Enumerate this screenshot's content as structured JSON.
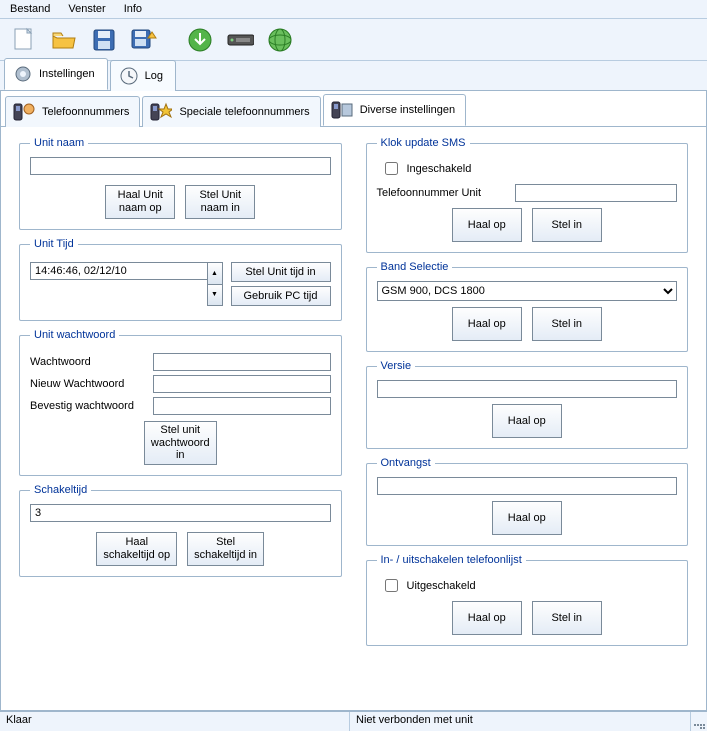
{
  "menu": {
    "file": "Bestand",
    "window": "Venster",
    "info": "Info"
  },
  "tabs": {
    "settings": "Instellingen",
    "log": "Log"
  },
  "subtabs": {
    "phone": "Telefoonnummers",
    "special": "Speciale telefoonnummers",
    "diverse": "Diverse instellingen"
  },
  "unitname": {
    "legend": "Unit naam",
    "value": "",
    "get": "Haal Unit\nnaam op",
    "set": "Stel Unit\nnaam in"
  },
  "unittime": {
    "legend": "Unit Tijd",
    "value": "14:46:46, 02/12/10",
    "set": "Stel Unit tijd in",
    "usepc": "Gebruik PC tijd"
  },
  "password": {
    "legend": "Unit wachtwoord",
    "pw": "Wachtwoord",
    "newpw": "Nieuw Wachtwoord",
    "confirm": "Bevestig wachtwoord",
    "set": "Stel unit\nwachtwoord\nin"
  },
  "switchtime": {
    "legend": "Schakeltijd",
    "value": "3",
    "get": "Haal\nschakeltijd op",
    "set": "Stel\nschakeltijd in"
  },
  "clocksms": {
    "legend": "Klok update SMS",
    "enabled": "Ingeschakeld",
    "phone_label": "Telefoonnummer Unit",
    "phone_value": "",
    "get": "Haal op",
    "set": "Stel in"
  },
  "band": {
    "legend": "Band Selectie",
    "value": "GSM 900, DCS 1800",
    "get": "Haal op",
    "set": "Stel in"
  },
  "version": {
    "legend": "Versie",
    "value": "",
    "get": "Haal op"
  },
  "reception": {
    "legend": "Ontvangst",
    "value": "",
    "get": "Haal op"
  },
  "phonelist": {
    "legend": "In- / uitschakelen telefoonlijst",
    "disabled": "Uitgeschakeld",
    "get": "Haal op",
    "set": "Stel in"
  },
  "status": {
    "left": "Klaar",
    "right": "Niet verbonden met unit"
  }
}
